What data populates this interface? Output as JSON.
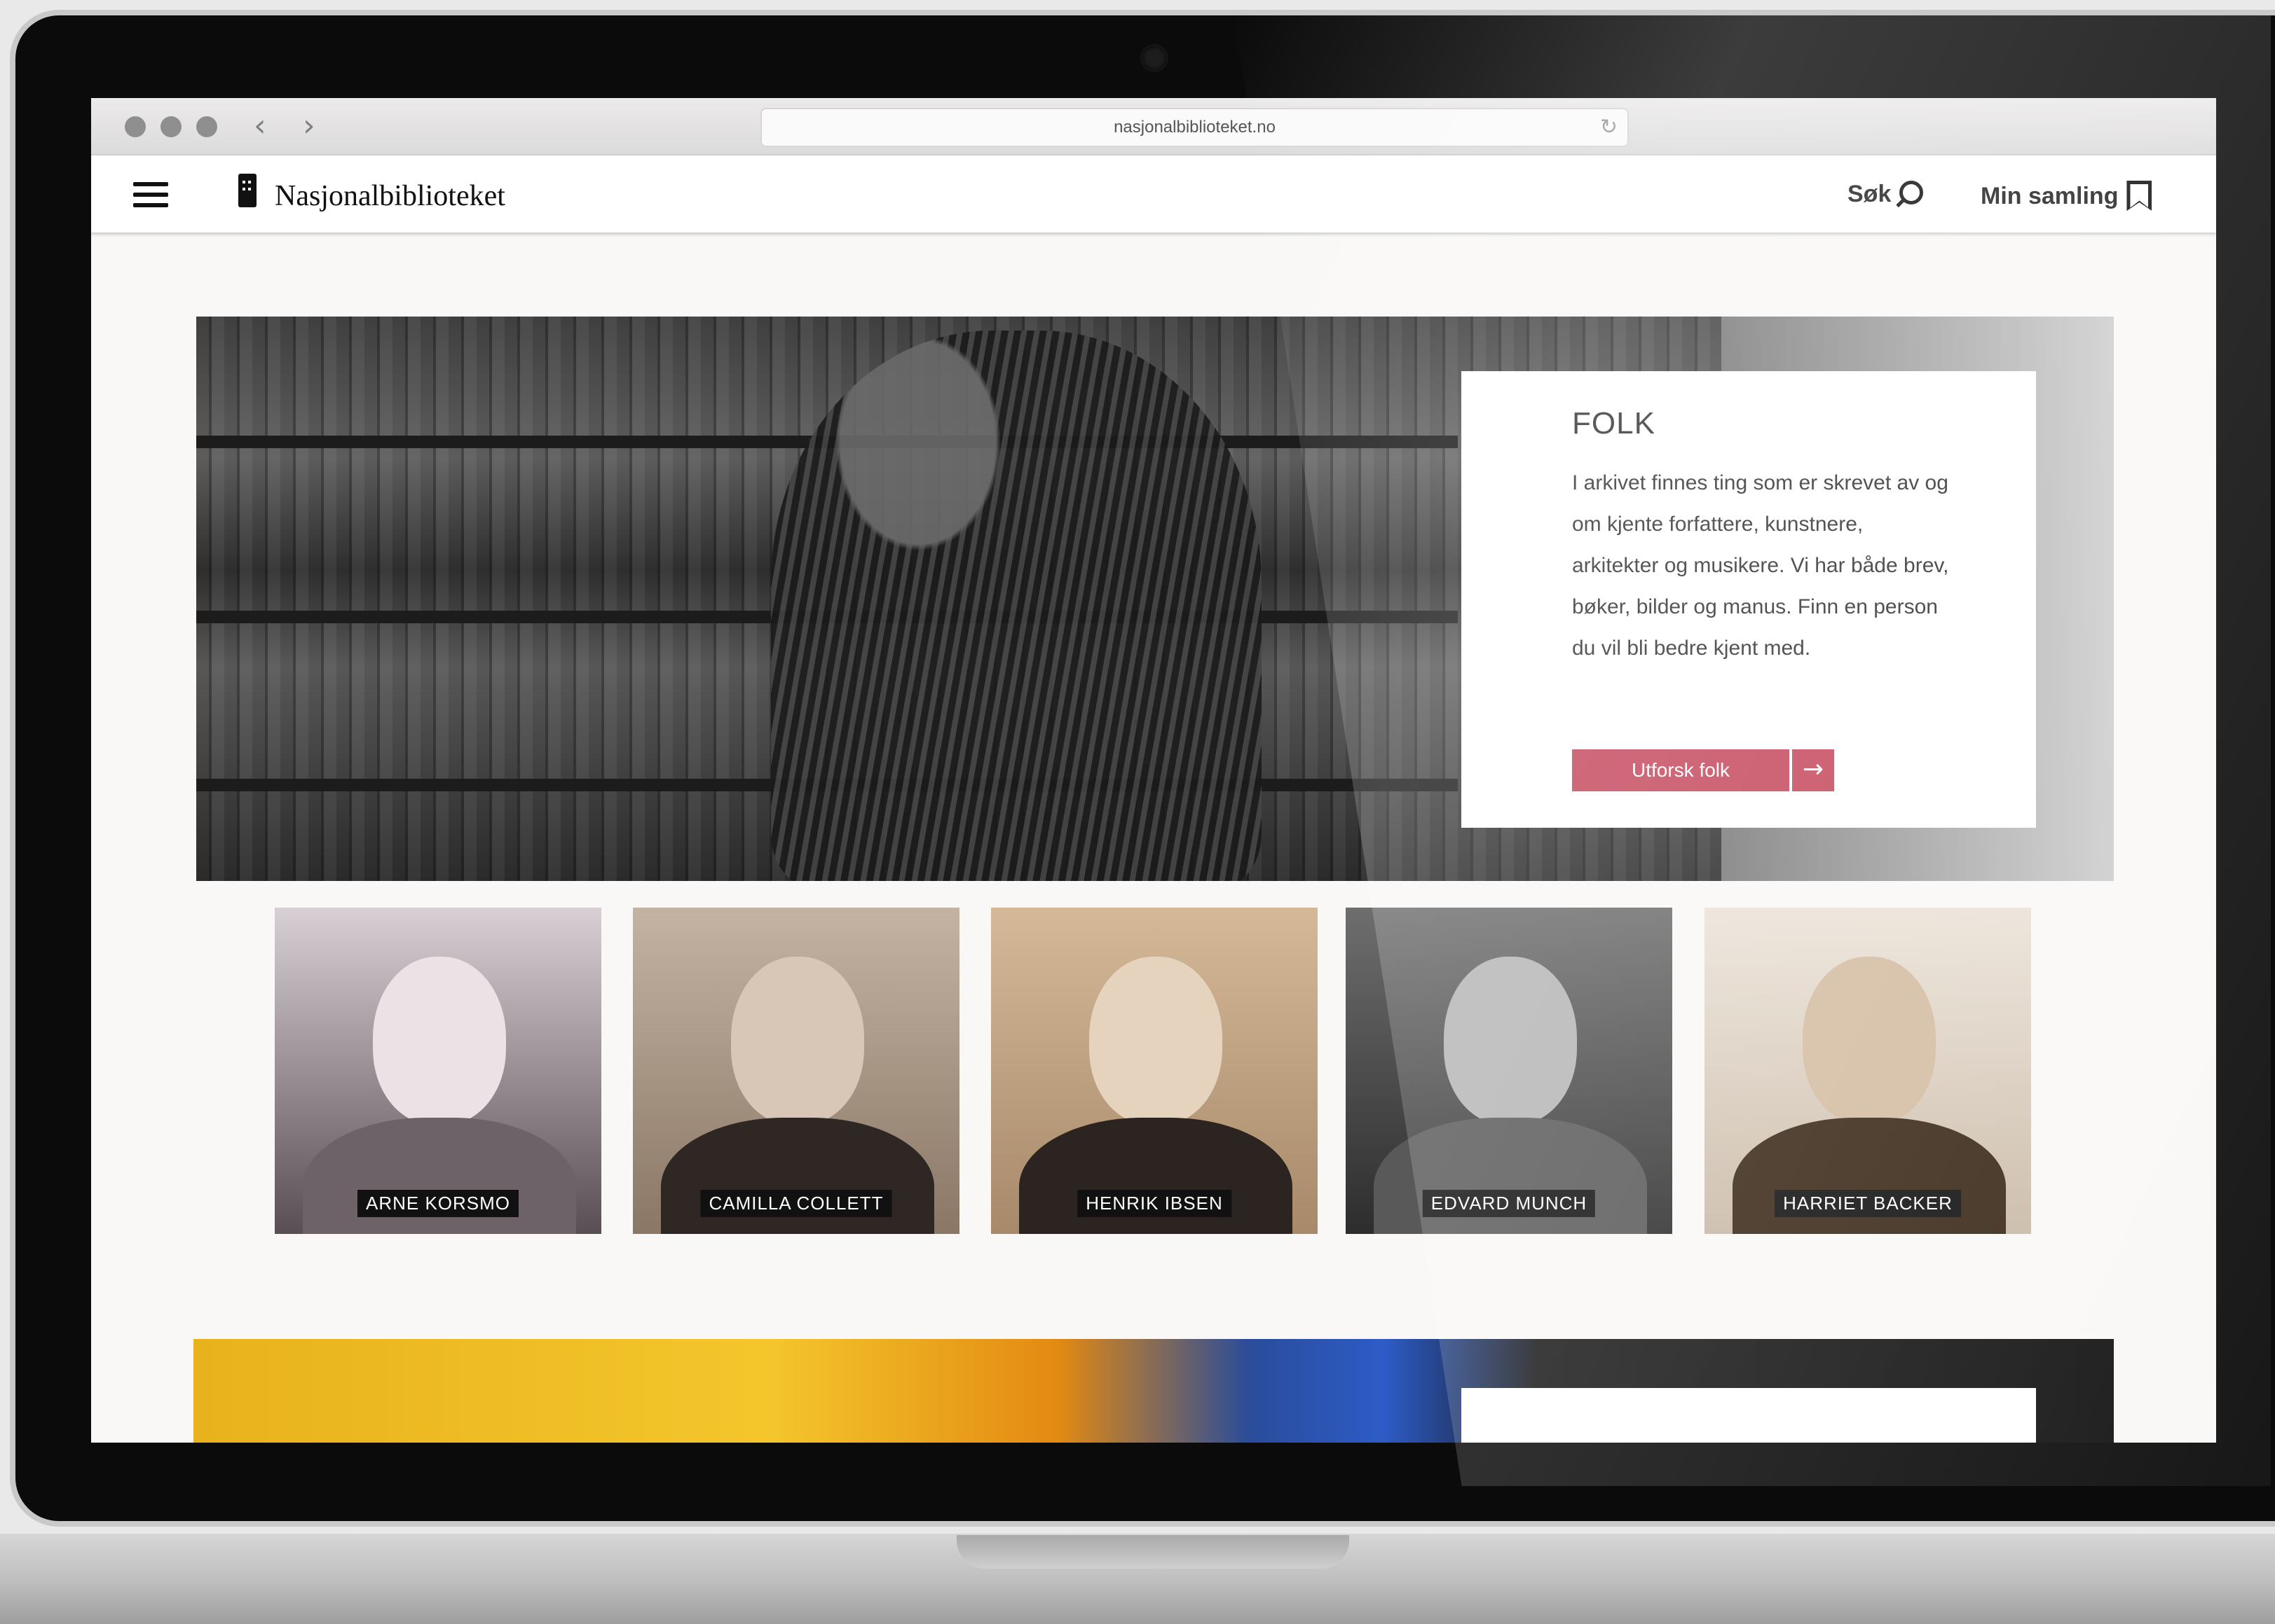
{
  "browser": {
    "url": "nasjonalbiblioteket.no",
    "back_icon": "chevron-left-icon",
    "forward_icon": "chevron-right-icon"
  },
  "header": {
    "logo_text": "Nasjonalbiblioteket",
    "search_label": "Søk",
    "collection_label": "Min samling"
  },
  "hero": {
    "title": "FOLK",
    "body": "I arkivet finnes ting som er skrevet av og om kjente forfattere, kunstnere, arkitekter og musikere. Vi har både brev, bøker, bilder og manus. Finn en person du vil bli bedre kjent med.",
    "button_label": "Utforsk folk"
  },
  "portraits": [
    {
      "name": "ARNE KORSMO"
    },
    {
      "name": "CAMILLA COLLETT"
    },
    {
      "name": "HENRIK IBSEN"
    },
    {
      "name": "EDVARD MUNCH"
    },
    {
      "name": "HARRIET BACKER"
    }
  ],
  "colors": {
    "accent": "#c5495e",
    "page_background": "#faf8f6"
  }
}
